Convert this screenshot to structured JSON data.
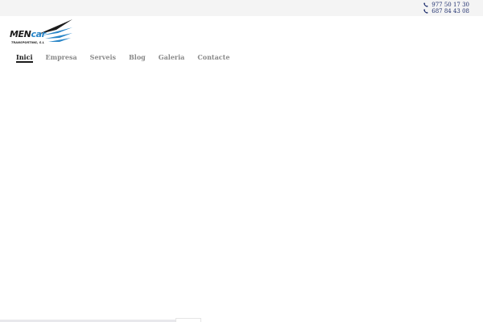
{
  "header": {
    "phones": [
      "977 50 17 30",
      "687 84 43 08"
    ],
    "phone_icon": "phone-icon",
    "phone_color": "#1f2f6e",
    "background": "#f4f4f4"
  },
  "logo": {
    "brand_part1": "MEN",
    "brand_part2": "car",
    "subtitle": "TRANSPORTING, S.L",
    "accent_color": "#2a86c8"
  },
  "nav": {
    "items": [
      {
        "label": "Inici",
        "active": true
      },
      {
        "label": "Empresa",
        "active": false
      },
      {
        "label": "Serveis",
        "active": false
      },
      {
        "label": "Blog",
        "active": false
      },
      {
        "label": "Galeria",
        "active": false
      },
      {
        "label": "Contacte",
        "active": false
      }
    ]
  }
}
